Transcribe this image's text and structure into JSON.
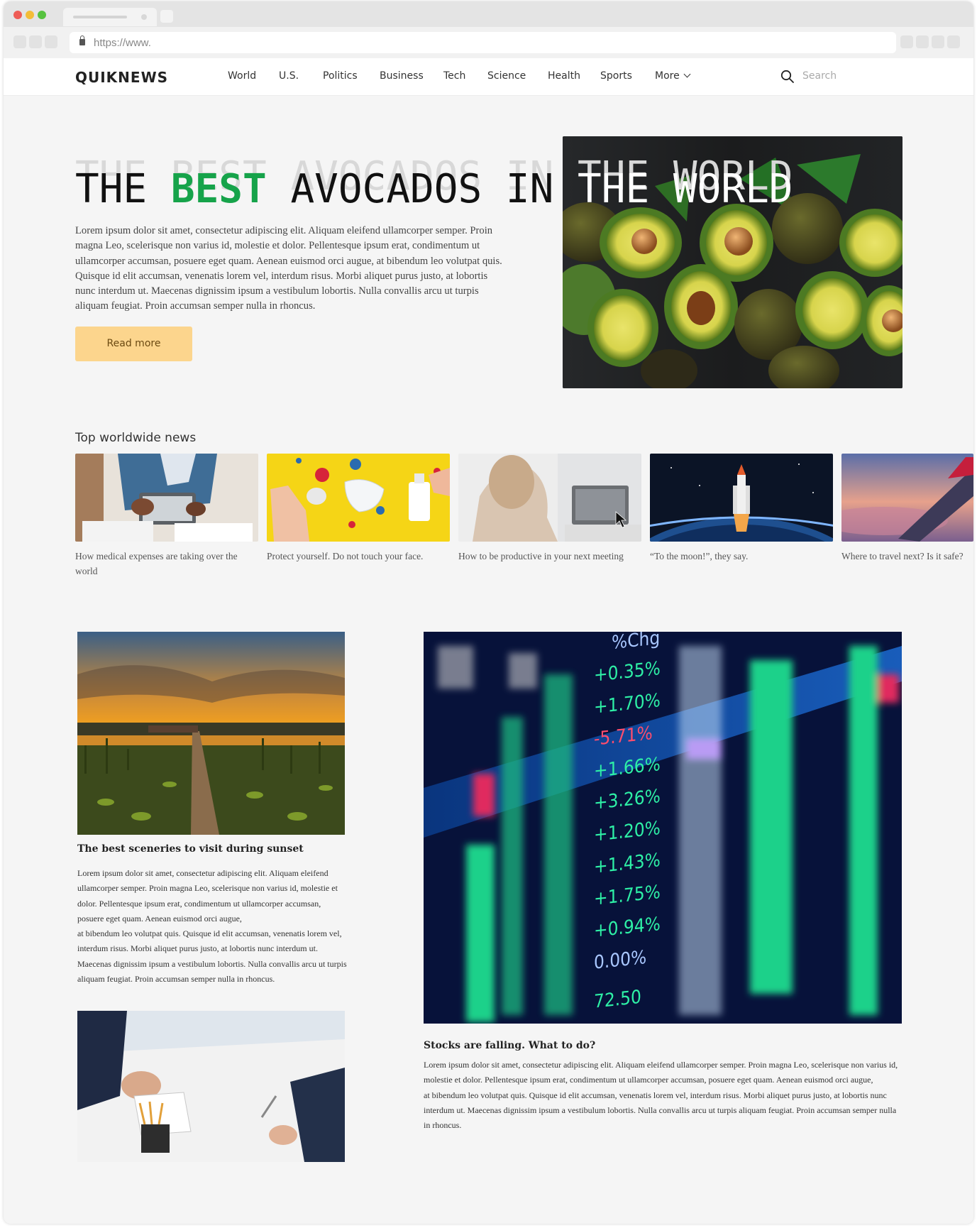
{
  "browser": {
    "url": "https://www."
  },
  "site": {
    "logo": "QUIKNEWS",
    "nav": [
      "World",
      "U.S.",
      "Politics",
      "Business",
      "Tech",
      "Science",
      "Health",
      "Sports",
      "More"
    ],
    "search_placeholder": "Search"
  },
  "hero": {
    "headline_parts": [
      "THE",
      "BEST",
      "AVOCADOS",
      "IN",
      "THE",
      "WORLD"
    ],
    "body": "Lorem ipsum dolor sit amet, consectetur adipiscing elit. Aliquam eleifend ullamcorper semper. Proin magna Leo, scelerisque non varius id, molestie et dolor. Pellentesque ipsum erat, condimentum ut ullamcorper accumsan, posuere eget quam. Aenean euismod orci augue, at bibendum leo volutpat quis. Quisque id elit accumsan, venenatis lorem vel, interdum risus. Morbi aliquet purus justo, at lobortis nunc interdum ut. Maecenas dignissim ipsum a vestibulum lobortis. Nulla convallis arcu ut turpis aliquam feugiat. Proin accumsan semper nulla in rhoncus.",
    "button": "Read more"
  },
  "top_news": {
    "title": "Top worldwide news",
    "items": [
      {
        "caption": "How medical expenses are taking over the world"
      },
      {
        "caption": "Protect yourself. Do not touch your face."
      },
      {
        "caption": "How to be productive in your next meeting"
      },
      {
        "caption": "“To the moon!”, they say."
      },
      {
        "caption": "Where to travel next? Is it safe?"
      }
    ]
  },
  "articles": {
    "sunset": {
      "title": "The best sceneries to visit during sunset",
      "body_1": "Lorem ipsum dolor sit amet, consectetur adipiscing elit. Aliquam eleifend ullamcorper semper. Proin magna Leo, scelerisque non varius id, molestie et dolor. Pellentesque ipsum erat, condimentum ut ullamcorper accumsan, posuere eget quam. Aenean euismod orci augue,",
      "body_2": "at bibendum leo volutpat quis. Quisque id elit accumsan, venenatis lorem vel, interdum risus. Morbi aliquet purus justo, at lobortis nunc interdum ut. Maecenas dignissim ipsum a vestibulum lobortis. Nulla convallis arcu ut turpis aliquam feugiat. Proin accumsan semper nulla in rhoncus."
    },
    "stocks": {
      "title": "Stocks are falling. What to do?",
      "body_1": "Lorem ipsum dolor sit amet, consectetur adipiscing elit. Aliquam eleifend ullamcorper semper. Proin magna Leo, scelerisque non varius id, molestie et dolor. Pellentesque ipsum erat, condimentum ut ullamcorper accumsan, posuere eget quam. Aenean euismod orci augue,",
      "body_2": "at bibendum leo volutpat quis. Quisque id elit accumsan, venenatis lorem vel, interdum risus. Morbi aliquet purus justo, at lobortis nunc interdum ut. Maecenas dignissim ipsum a vestibulum lobortis. Nulla convallis arcu ut turpis aliquam feugiat. Proin accumsan semper nulla in rhoncus.",
      "board_header": "%Chg",
      "board_values": [
        "+0.35%",
        "+1.70%",
        "-5.71%",
        "+1.66%",
        "+3.26%",
        "+1.20%",
        "+1.43%",
        "+1.75%",
        "+0.94%",
        "0.00%",
        "72.50"
      ]
    }
  },
  "colors": {
    "accent_green": "#16a34a",
    "button_bg": "#fcd58d"
  }
}
